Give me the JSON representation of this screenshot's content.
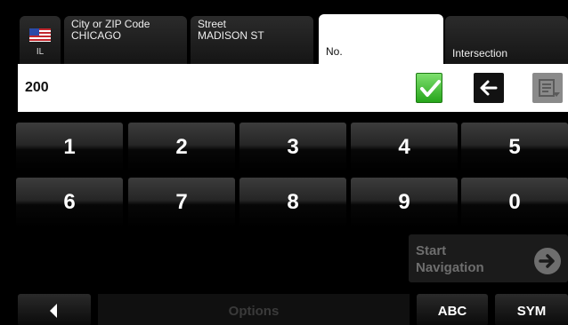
{
  "tabs": {
    "country": {
      "label": "IL",
      "flag": "us-flag-icon"
    },
    "city": {
      "title": "City or ZIP Code",
      "value": "CHICAGO"
    },
    "street": {
      "title": "Street",
      "value": "MADISON ST"
    },
    "number": {
      "title": "No."
    },
    "intersection": {
      "title": "Intersection"
    }
  },
  "entry": {
    "value": "200"
  },
  "entry_buttons": {
    "confirm_icon": "checkmark-icon",
    "backspace_icon": "left-arrow-icon",
    "list_icon": "list-dropdown-icon"
  },
  "keypad": {
    "row1": [
      "1",
      "2",
      "3",
      "4",
      "5"
    ],
    "row2": [
      "6",
      "7",
      "8",
      "9",
      "0"
    ]
  },
  "start_navigation": {
    "line1": "Start",
    "line2": "Navigation",
    "icon": "right-arrow-circle-icon"
  },
  "bottom_bar": {
    "back_icon": "left-triangle-icon",
    "options_label": "Options",
    "abc_label": "ABC",
    "sym_label": "SYM"
  },
  "colors": {
    "confirm_green": "#2fae22",
    "background": "#000000",
    "disabled_text": "#6e6e6e"
  }
}
